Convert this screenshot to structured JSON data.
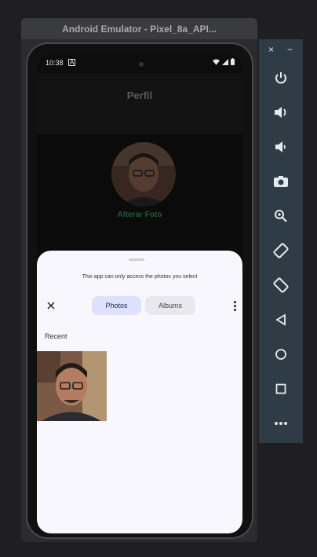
{
  "emulator": {
    "title": "Android Emulator - Pixel_8a_API...",
    "close_label": "×",
    "minimize_label": "−",
    "side_buttons": [
      "power-icon",
      "volume-up-icon",
      "volume-down-icon",
      "camera-icon",
      "zoom-icon",
      "rotate-left-icon",
      "rotate-right-icon",
      "back-icon",
      "home-icon",
      "overview-icon",
      "more-icon"
    ]
  },
  "status_bar": {
    "time": "10:38",
    "notif": "A"
  },
  "app": {
    "title": "Perfil",
    "change_photo": "Alterar Foto"
  },
  "picker": {
    "notice": "This app can only access the photos you select",
    "tabs": [
      {
        "label": "Photos",
        "selected": true
      },
      {
        "label": "Albums",
        "selected": false
      }
    ],
    "section": "Recent",
    "accent": "#dde1fb"
  }
}
